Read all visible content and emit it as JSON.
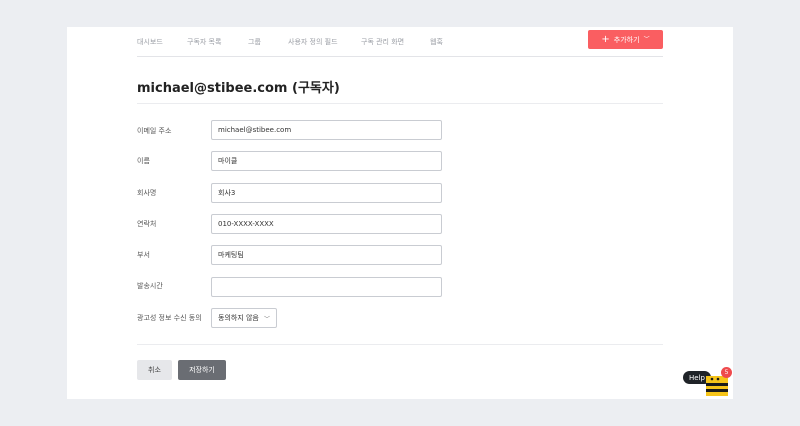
{
  "nav": {
    "items": [
      "대시보드",
      "구독자 목록",
      "그룹",
      "사용자 정의 필드",
      "구독 관리 화면",
      "웹훅"
    ],
    "add_button_label": "추가하기"
  },
  "page": {
    "title": "michael@stibee.com (구독자)"
  },
  "form": {
    "fields": [
      {
        "label": "이메일 주소",
        "value": "michael@stibee.com"
      },
      {
        "label": "이름",
        "value": "마이클"
      },
      {
        "label": "회사명",
        "value": "회사3"
      },
      {
        "label": "연락처",
        "value": "010-XXXX-XXXX"
      },
      {
        "label": "부서",
        "value": "마케팅팀"
      },
      {
        "label": "발송시간",
        "value": ""
      }
    ],
    "consent": {
      "label": "광고성 정보 수신 동의",
      "selected": "동의하지 않음"
    }
  },
  "actions": {
    "cancel_label": "취소",
    "save_label": "저장하기"
  },
  "help": {
    "label": "Help",
    "badge_count": "5"
  },
  "colors": {
    "accent": "#fa5e61",
    "save_button": "#6a6d73",
    "background": "#eceef2"
  }
}
